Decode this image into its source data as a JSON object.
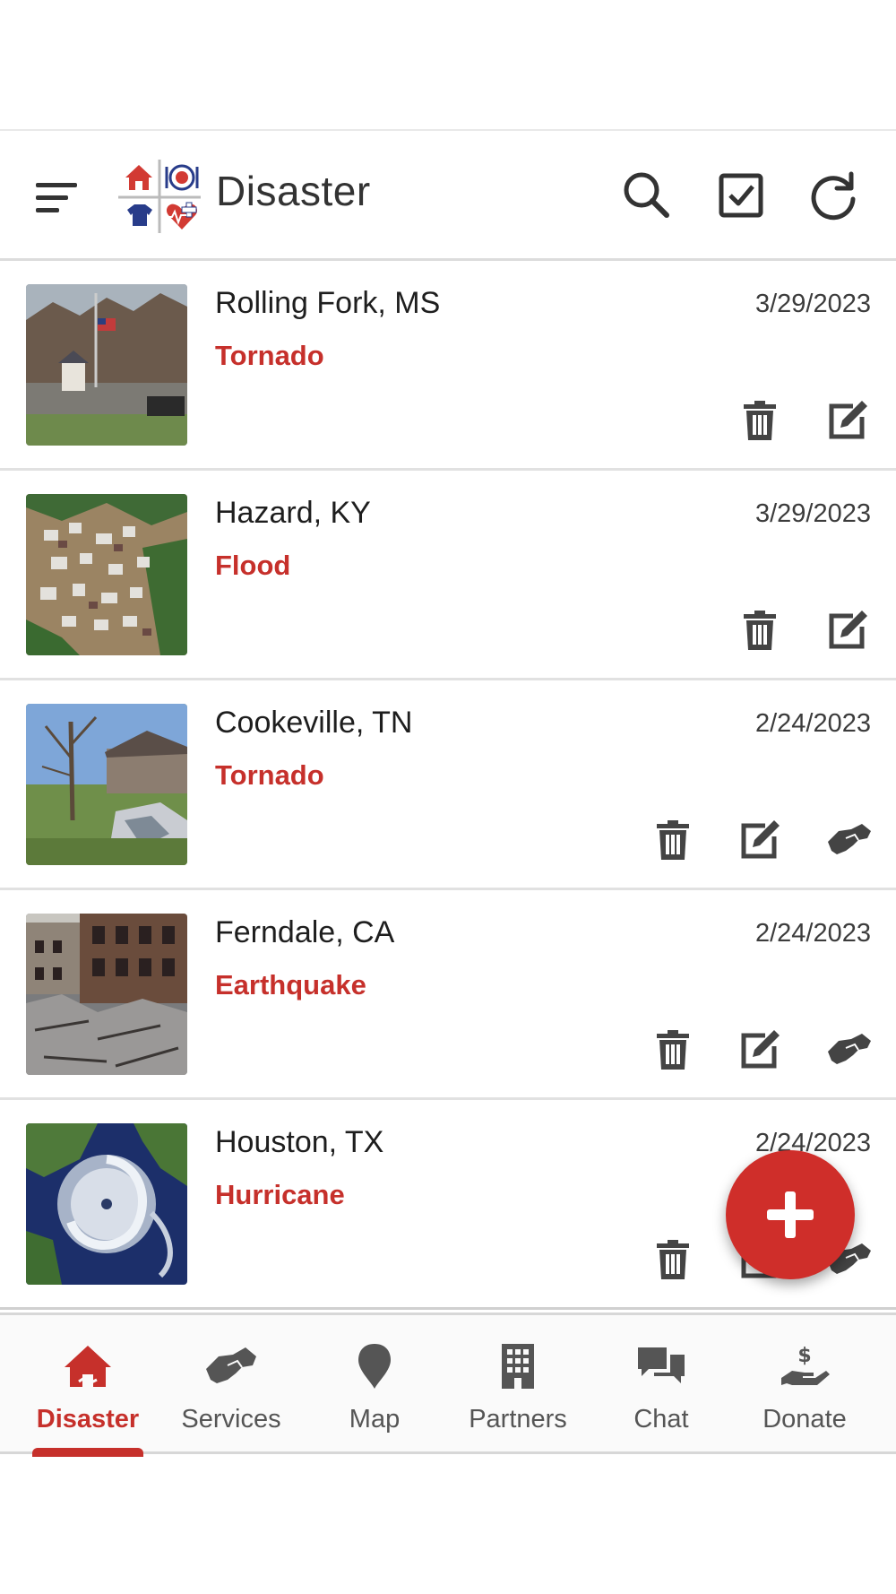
{
  "app": {
    "title": "Disaster"
  },
  "colors": {
    "accent": "#c6302b",
    "icon": "#444444",
    "fab": "#cf2e2a"
  },
  "header": {
    "icons": [
      "menu-icon",
      "app-logo",
      "search-icon",
      "checkbox-icon",
      "refresh-icon"
    ]
  },
  "disasters": [
    {
      "place": "Rolling Fork, MS",
      "type": "Tornado",
      "date": "3/29/2023",
      "actions": [
        "delete-icon",
        "edit-icon"
      ]
    },
    {
      "place": "Hazard, KY",
      "type": "Flood",
      "date": "3/29/2023",
      "actions": [
        "delete-icon",
        "edit-icon"
      ]
    },
    {
      "place": "Cookeville, TN",
      "type": "Tornado",
      "date": "2/24/2023",
      "actions": [
        "delete-icon",
        "edit-icon",
        "handshake-icon"
      ]
    },
    {
      "place": "Ferndale, CA",
      "type": "Earthquake",
      "date": "2/24/2023",
      "actions": [
        "delete-icon",
        "edit-icon",
        "handshake-icon"
      ]
    },
    {
      "place": "Houston, TX",
      "type": "Hurricane",
      "date": "2/24/2023",
      "actions": [
        "delete-icon",
        "edit-icon",
        "handshake-icon"
      ]
    }
  ],
  "fab": {
    "icon": "plus-icon"
  },
  "nav": {
    "items": [
      {
        "label": "Disaster",
        "icon": "home-icon",
        "active": true
      },
      {
        "label": "Services",
        "icon": "handshake-icon",
        "active": false
      },
      {
        "label": "Map",
        "icon": "map-marker-icon",
        "active": false
      },
      {
        "label": "Partners",
        "icon": "building-icon",
        "active": false
      },
      {
        "label": "Chat",
        "icon": "chat-icon",
        "active": false
      },
      {
        "label": "Donate",
        "icon": "donate-icon",
        "active": false
      }
    ]
  }
}
